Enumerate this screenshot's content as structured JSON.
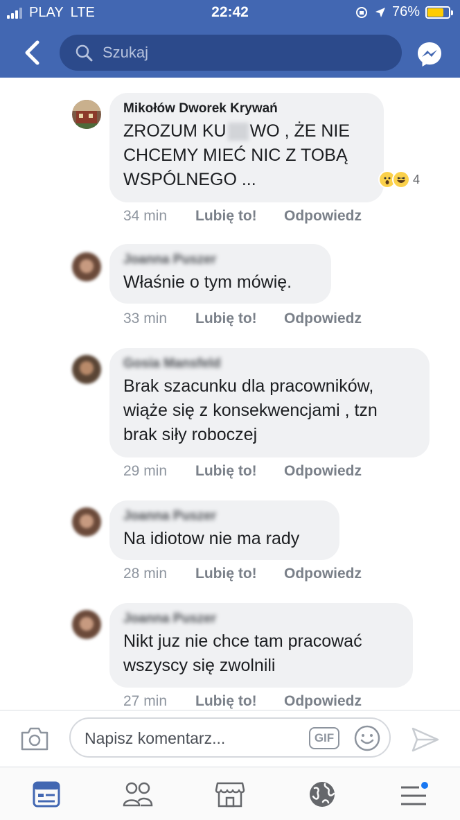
{
  "status_bar": {
    "carrier": "PLAY",
    "network": "LTE",
    "time": "22:42",
    "battery": "76%",
    "battery_level": 0.76
  },
  "header": {
    "search_placeholder": "Szukaj"
  },
  "comments": [
    {
      "author": "Mikołów Dworek Krywań",
      "text_parts": [
        "ZROZUM KU",
        "WO , ŻE NIE CHCEMY MIEĆ NIC Z TOBĄ WSPÓLNEGO ..."
      ],
      "reactions": [
        "wow-reaction-icon",
        "haha-reaction-icon"
      ],
      "reaction_count": "4",
      "time": "34 min",
      "like": "Lubię to!",
      "reply": "Odpowiedz"
    },
    {
      "author": "Joanna Puszer",
      "text": "Właśnie o tym mówię.",
      "time": "33 min",
      "like": "Lubię to!",
      "reply": "Odpowiedz"
    },
    {
      "author": "Gosia Mansfeld",
      "text": "Brak szacunku dla pracowników, wiąże się z konsekwencjami , tzn brak siły roboczej",
      "time": "29 min",
      "like": "Lubię to!",
      "reply": "Odpowiedz"
    },
    {
      "author": "Joanna Puszer",
      "text": "Na idiotow nie ma rady",
      "time": "28 min",
      "like": "Lubię to!",
      "reply": "Odpowiedz"
    },
    {
      "author": "Joanna Puszer",
      "text": "Nikt juz nie chce tam pracować wszyscy się zwolnili",
      "time": "27 min",
      "like": "Lubię to!",
      "reply": "Odpowiedz"
    }
  ],
  "composer": {
    "placeholder": "Napisz komentarz...",
    "gif_label": "GIF"
  },
  "tabbar": {
    "items": [
      "news-feed-icon",
      "friends-icon",
      "marketplace-icon",
      "notifications-globe-icon",
      "menu-icon"
    ]
  },
  "colors": {
    "brand": "#4267b2",
    "bubble": "#f0f1f3",
    "meta": "#8d949e"
  }
}
